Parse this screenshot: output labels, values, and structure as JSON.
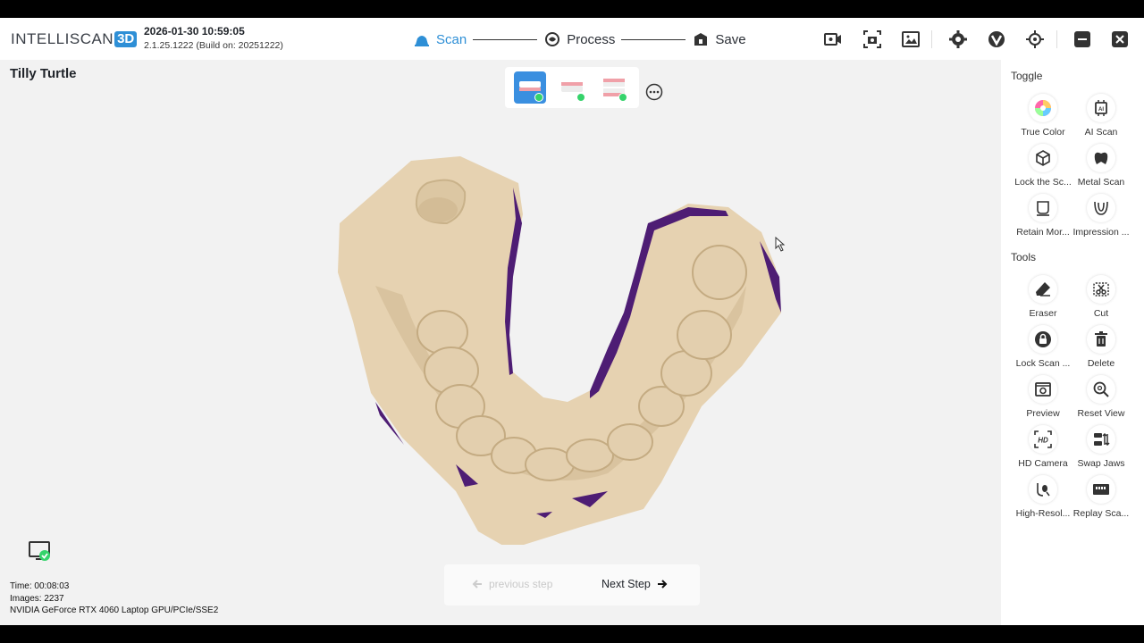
{
  "header": {
    "logo_text": "INTELLISCAN",
    "logo_badge": "3D",
    "datetime": "2026-01-30 10:59:05",
    "version": "2.1.25.1222 (Build on: 20251222)",
    "steps": [
      {
        "label": "Scan",
        "icon": "scan-icon"
      },
      {
        "label": "Process",
        "icon": "process-icon"
      },
      {
        "label": "Save",
        "icon": "save-icon"
      }
    ],
    "buttons": [
      "record-video-icon",
      "screenshot-icon",
      "gallery-icon",
      "settings-icon",
      "brand-v-icon",
      "crosshair-icon",
      "minimize-icon",
      "close-icon"
    ]
  },
  "patient_name": "Tilly Turtle",
  "jaw_selector": [
    "upper-jaw-icon",
    "lower-jaw-icon",
    "bite-icon"
  ],
  "status": {
    "time": "Time: 00:08:03",
    "images": "Images: 2237",
    "gpu": "NVIDIA GeForce RTX 4060 Laptop GPU/PCIe/SSE2"
  },
  "nav": {
    "previous": "previous step",
    "next": "Next Step"
  },
  "panel": {
    "toggle_title": "Toggle",
    "toggle_items": [
      {
        "label": "True Color",
        "icon": "color-wheel-icon"
      },
      {
        "label": "AI Scan",
        "icon": "ai-chip-icon"
      },
      {
        "label": "Lock the Sc...",
        "icon": "cube-lock-icon"
      },
      {
        "label": "Metal Scan",
        "icon": "metal-tooth-icon"
      },
      {
        "label": "Retain Mor...",
        "icon": "retain-tooth-icon"
      },
      {
        "label": "Impression ...",
        "icon": "impression-icon"
      }
    ],
    "tools_title": "Tools",
    "tool_items": [
      {
        "label": "Eraser",
        "icon": "eraser-icon"
      },
      {
        "label": "Cut",
        "icon": "cut-icon"
      },
      {
        "label": "Lock Scan ...",
        "icon": "lock-icon"
      },
      {
        "label": "Delete",
        "icon": "trash-icon"
      },
      {
        "label": "Preview",
        "icon": "preview-icon"
      },
      {
        "label": "Reset View",
        "icon": "zoom-reset-icon"
      },
      {
        "label": "HD Camera",
        "icon": "hd-camera-icon"
      },
      {
        "label": "Swap Jaws",
        "icon": "swap-jaws-icon"
      },
      {
        "label": "High-Resol...",
        "icon": "high-res-icon"
      },
      {
        "label": "Replay Sca...",
        "icon": "replay-scan-icon"
      }
    ]
  },
  "colors": {
    "accent": "#2e8fd6",
    "model": "#e6d2b1",
    "gap_edges": "#4e1d74",
    "status_dot": "#35d36b"
  }
}
